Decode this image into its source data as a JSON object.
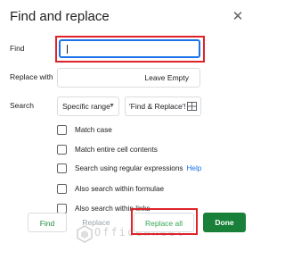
{
  "dialog": {
    "title": "Find and replace",
    "close_icon": "close-icon"
  },
  "find": {
    "label": "Find",
    "value": ""
  },
  "replace": {
    "label": "Replace with",
    "value": "Leave Empty"
  },
  "search": {
    "label": "Search",
    "scope_selected": "Specific range",
    "range_value": "'Find & Replace'!",
    "grid_icon": "grid-icon"
  },
  "options": [
    {
      "label": "Match case",
      "checked": false
    },
    {
      "label": "Match entire cell contents",
      "checked": false
    },
    {
      "label": "Search using regular expressions",
      "checked": false,
      "help": "Help"
    },
    {
      "label": "Also search within formulae",
      "checked": false
    },
    {
      "label": "Also search within links",
      "checked": false
    }
  ],
  "buttons": {
    "find": "Find",
    "replace": "Replace",
    "replace_all": "Replace all",
    "done": "Done"
  },
  "colors": {
    "accent_blue": "#1a73e8",
    "done_green": "#188038",
    "highlight_red": "#e0232a"
  },
  "watermark": "OfficeWheel"
}
